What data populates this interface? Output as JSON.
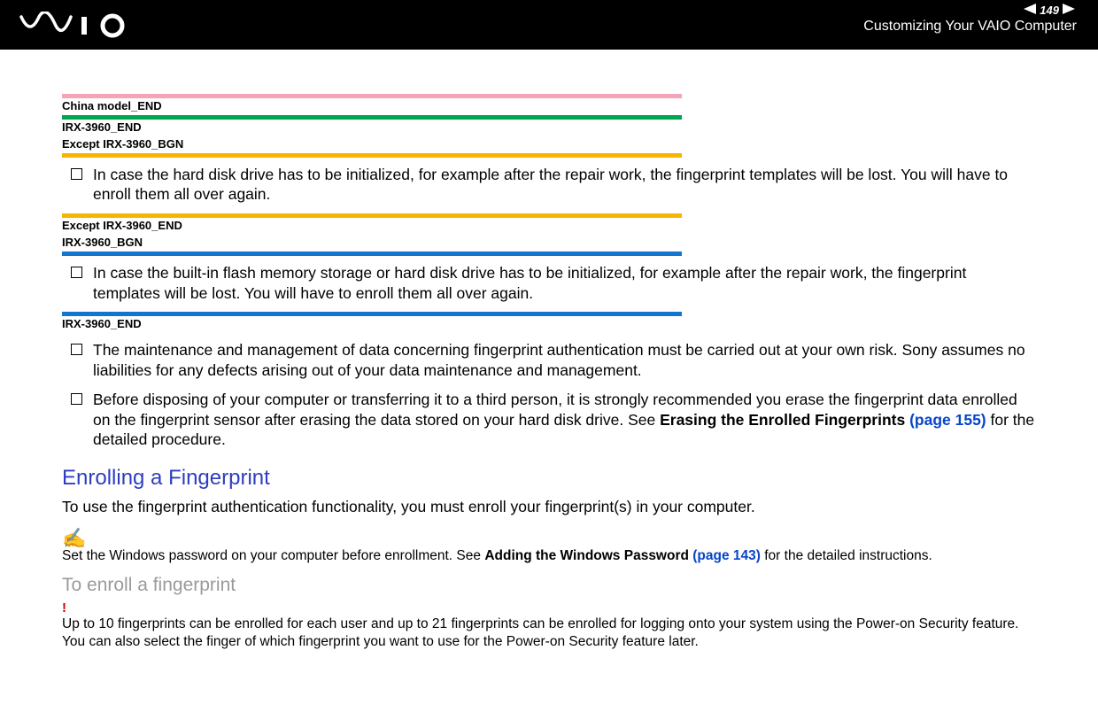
{
  "header": {
    "page_number": "149",
    "section": "Customizing Your VAIO Computer"
  },
  "tags": {
    "china_end": "China model_END",
    "irx_end": "IRX-3960_END",
    "except_irx_bgn": "Except IRX-3960_BGN",
    "except_irx_end": "Except IRX-3960_END",
    "irx_bgn": "IRX-3960_BGN",
    "irx_end2": "IRX-3960_END"
  },
  "bullets": {
    "b1": "In case the hard disk drive has to be initialized, for example after the repair work, the fingerprint templates will be lost. You will have to enroll them all over again.",
    "b2": "In case the built-in flash memory storage or hard disk drive has to be initialized, for example after the repair work, the fingerprint templates will be lost. You will have to enroll them all over again.",
    "b3": "The maintenance and management of data concerning fingerprint authentication must be carried out at your own risk. Sony assumes no liabilities for any defects arising out of your data maintenance and management.",
    "b4_pre": "Before disposing of your computer or transferring it to a third person, it is strongly recommended you erase the fingerprint data enrolled on the fingerprint sensor after erasing the data stored on your hard disk drive. See ",
    "b4_bold": "Erasing the Enrolled Fingerprints ",
    "b4_link": "(page 155)",
    "b4_post": " for the detailed procedure."
  },
  "h2": "Enrolling a Fingerprint",
  "para1": "To use the fingerprint authentication functionality, you must enroll your fingerprint(s) in your computer.",
  "note": {
    "icon": "✍",
    "pre": "Set the Windows password on your computer before enrollment. See ",
    "bold": "Adding the Windows Password ",
    "link": "(page 143)",
    "post": " for the detailed instructions."
  },
  "h3": "To enroll a fingerprint",
  "alert": {
    "mark": "!",
    "text": "Up to 10 fingerprints can be enrolled for each user and up to 21 fingerprints can be enrolled for logging onto your system using the Power-on Security feature. You can also select the finger of which fingerprint you want to use for the Power-on Security feature later."
  }
}
